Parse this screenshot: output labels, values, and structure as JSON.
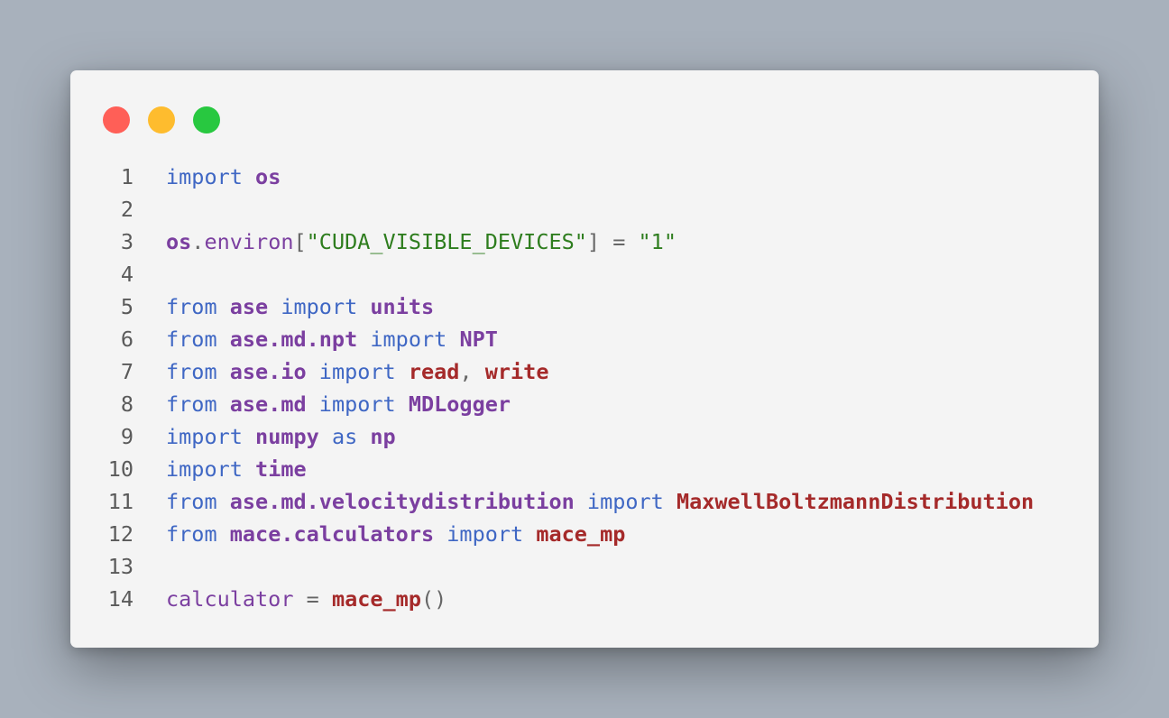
{
  "window": {
    "controls": {
      "close_color": "#ff5f57",
      "minimize_color": "#febc2e",
      "zoom_color": "#28c840"
    }
  },
  "colors": {
    "keyword": "#3f67c4",
    "module": "#7b3fa0",
    "identifier": "#7b3fa0",
    "function": "#a52a2a",
    "string": "#2e7d1e",
    "punctuation": "#666666",
    "line_number": "#5a5a5a",
    "background": "#f4f4f4"
  },
  "code": {
    "lines": [
      {
        "number": "1",
        "tokens": [
          {
            "text": "import",
            "type": "keyword"
          },
          {
            "text": " ",
            "type": "space"
          },
          {
            "text": "os",
            "type": "module"
          }
        ]
      },
      {
        "number": "2",
        "tokens": []
      },
      {
        "number": "3",
        "tokens": [
          {
            "text": "os",
            "type": "module"
          },
          {
            "text": ".",
            "type": "punctuation"
          },
          {
            "text": "environ",
            "type": "identifier"
          },
          {
            "text": "[",
            "type": "punctuation"
          },
          {
            "text": "\"CUDA_VISIBLE_DEVICES\"",
            "type": "string"
          },
          {
            "text": "]",
            "type": "punctuation"
          },
          {
            "text": " = ",
            "type": "punctuation"
          },
          {
            "text": "\"1\"",
            "type": "string"
          }
        ]
      },
      {
        "number": "4",
        "tokens": []
      },
      {
        "number": "5",
        "tokens": [
          {
            "text": "from",
            "type": "keyword"
          },
          {
            "text": " ",
            "type": "space"
          },
          {
            "text": "ase",
            "type": "module"
          },
          {
            "text": " ",
            "type": "space"
          },
          {
            "text": "import",
            "type": "keyword"
          },
          {
            "text": " ",
            "type": "space"
          },
          {
            "text": "units",
            "type": "module"
          }
        ]
      },
      {
        "number": "6",
        "tokens": [
          {
            "text": "from",
            "type": "keyword"
          },
          {
            "text": " ",
            "type": "space"
          },
          {
            "text": "ase.md.npt",
            "type": "module"
          },
          {
            "text": " ",
            "type": "space"
          },
          {
            "text": "import",
            "type": "keyword"
          },
          {
            "text": " ",
            "type": "space"
          },
          {
            "text": "NPT",
            "type": "module"
          }
        ]
      },
      {
        "number": "7",
        "tokens": [
          {
            "text": "from",
            "type": "keyword"
          },
          {
            "text": " ",
            "type": "space"
          },
          {
            "text": "ase.io",
            "type": "module"
          },
          {
            "text": " ",
            "type": "space"
          },
          {
            "text": "import",
            "type": "keyword"
          },
          {
            "text": " ",
            "type": "space"
          },
          {
            "text": "read",
            "type": "function"
          },
          {
            "text": ", ",
            "type": "punctuation"
          },
          {
            "text": "write",
            "type": "function"
          }
        ]
      },
      {
        "number": "8",
        "tokens": [
          {
            "text": "from",
            "type": "keyword"
          },
          {
            "text": " ",
            "type": "space"
          },
          {
            "text": "ase.md",
            "type": "module"
          },
          {
            "text": " ",
            "type": "space"
          },
          {
            "text": "import",
            "type": "keyword"
          },
          {
            "text": " ",
            "type": "space"
          },
          {
            "text": "MDLogger",
            "type": "module"
          }
        ]
      },
      {
        "number": "9",
        "tokens": [
          {
            "text": "import",
            "type": "keyword"
          },
          {
            "text": " ",
            "type": "space"
          },
          {
            "text": "numpy",
            "type": "module"
          },
          {
            "text": " ",
            "type": "space"
          },
          {
            "text": "as",
            "type": "keyword"
          },
          {
            "text": " ",
            "type": "space"
          },
          {
            "text": "np",
            "type": "module"
          }
        ]
      },
      {
        "number": "10",
        "tokens": [
          {
            "text": "import",
            "type": "keyword"
          },
          {
            "text": " ",
            "type": "space"
          },
          {
            "text": "time",
            "type": "module"
          }
        ]
      },
      {
        "number": "11",
        "tokens": [
          {
            "text": "from",
            "type": "keyword"
          },
          {
            "text": " ",
            "type": "space"
          },
          {
            "text": "ase.md.velocitydistribution",
            "type": "module"
          },
          {
            "text": " ",
            "type": "space"
          },
          {
            "text": "import",
            "type": "keyword"
          },
          {
            "text": " ",
            "type": "space"
          },
          {
            "text": "MaxwellBoltzmannDistribution",
            "type": "function"
          }
        ]
      },
      {
        "number": "12",
        "tokens": [
          {
            "text": "from",
            "type": "keyword"
          },
          {
            "text": " ",
            "type": "space"
          },
          {
            "text": "mace.calculators",
            "type": "module"
          },
          {
            "text": " ",
            "type": "space"
          },
          {
            "text": "import",
            "type": "keyword"
          },
          {
            "text": " ",
            "type": "space"
          },
          {
            "text": "mace_mp",
            "type": "function"
          }
        ]
      },
      {
        "number": "13",
        "tokens": []
      },
      {
        "number": "14",
        "tokens": [
          {
            "text": "calculator",
            "type": "identifier"
          },
          {
            "text": " = ",
            "type": "punctuation"
          },
          {
            "text": "mace_mp",
            "type": "function"
          },
          {
            "text": "()",
            "type": "punctuation"
          }
        ]
      }
    ]
  }
}
